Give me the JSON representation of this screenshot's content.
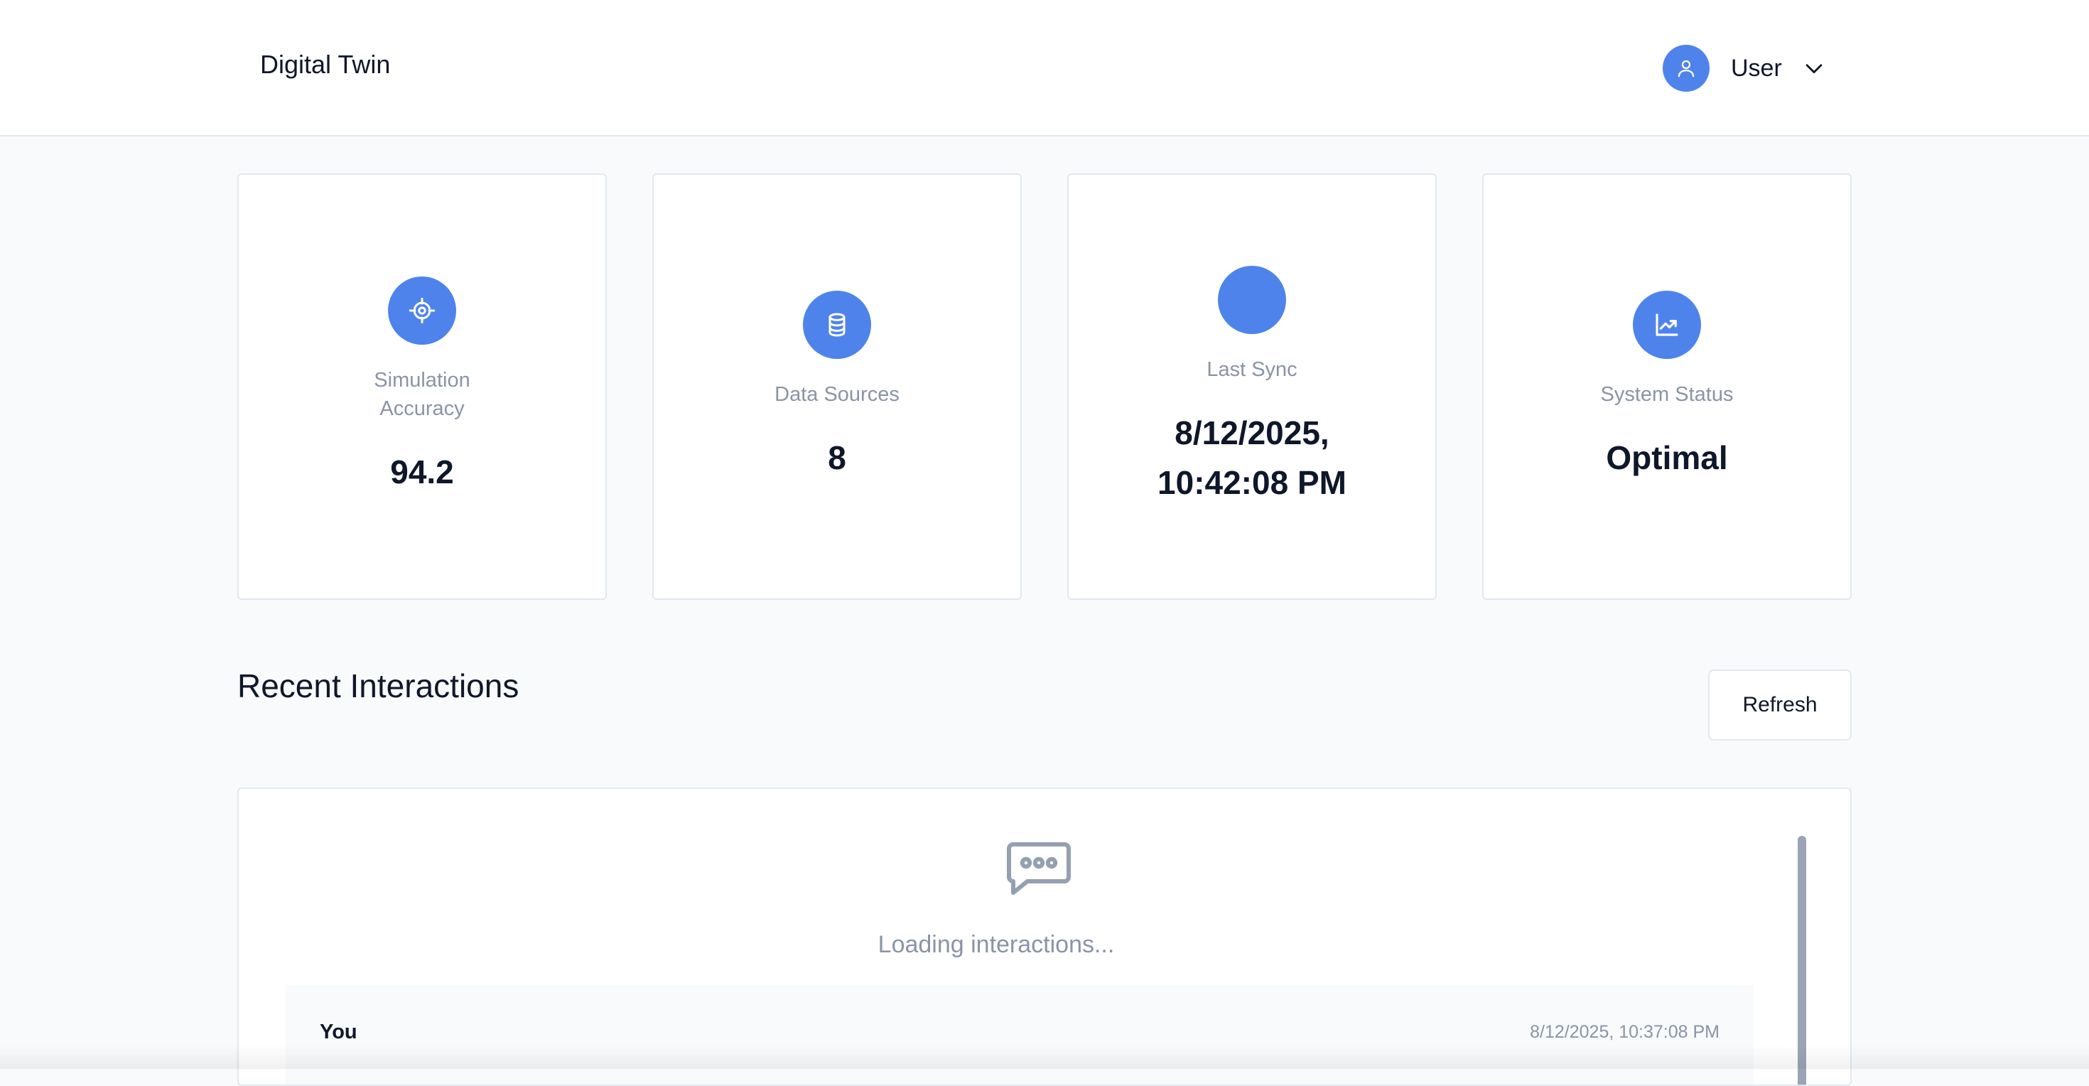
{
  "header": {
    "brand": "Digital Twin",
    "user_label": "User",
    "avatar_icon": "user-icon",
    "chevron_icon": "chevron-down-icon"
  },
  "stats": [
    {
      "icon": "target-icon",
      "label": "Simulation Accuracy",
      "value": "94.2"
    },
    {
      "icon": "database-icon",
      "label": "Data Sources",
      "value": "8"
    },
    {
      "icon": "blank-circle-icon",
      "label": "Last Sync",
      "value": "8/12/2025, 10:42:08 PM"
    },
    {
      "icon": "chart-line-icon",
      "label": "System Status",
      "value": "Optimal"
    }
  ],
  "interactions": {
    "title": "Recent Interactions",
    "refresh_label": "Refresh",
    "loading_text": "Loading interactions...",
    "empty_icon": "chat-bubble-icon",
    "items": [
      {
        "author": "You",
        "timestamp": "8/12/2025, 10:37:08 PM"
      }
    ]
  },
  "colors": {
    "accent": "#4f83ec",
    "text_primary": "#0f172a",
    "text_muted": "#8a94a6",
    "background": "#f8fafc",
    "border": "#e2e8f0"
  }
}
